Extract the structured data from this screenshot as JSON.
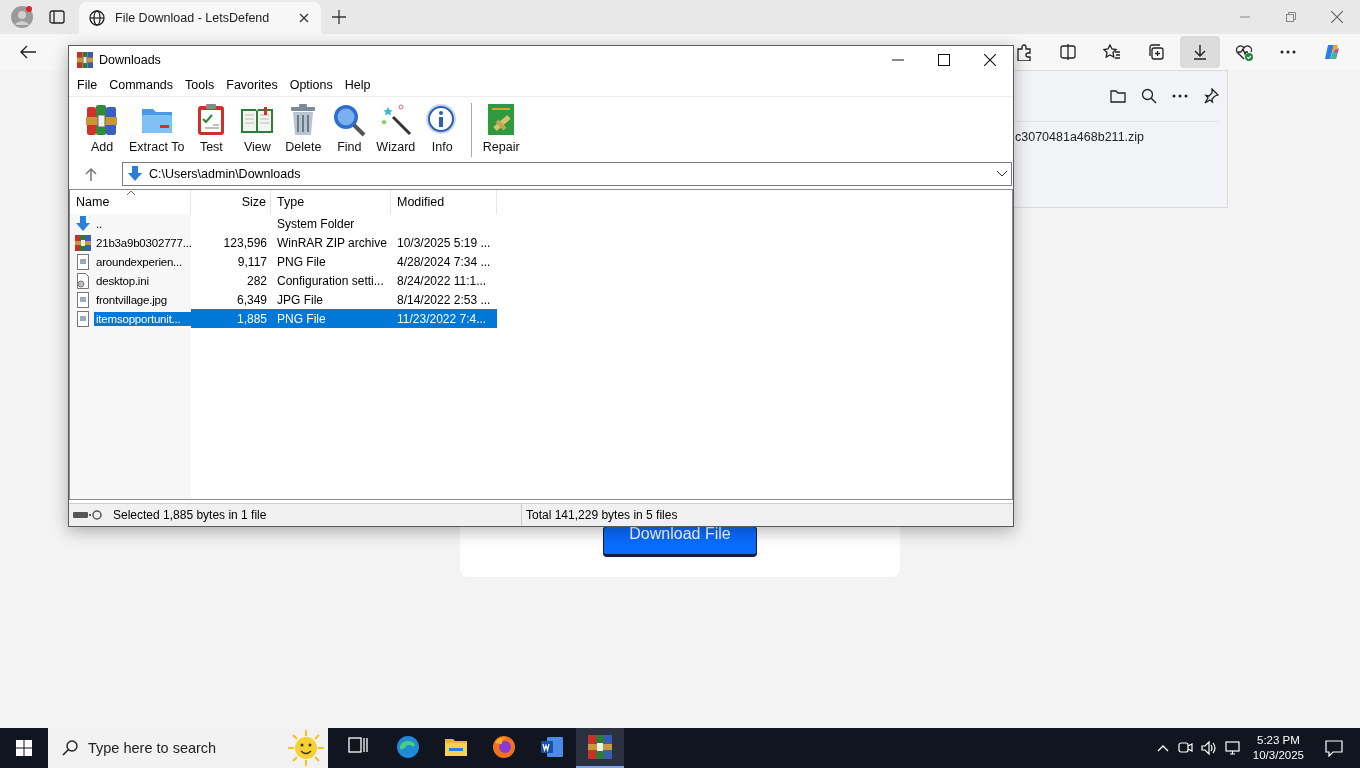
{
  "browser": {
    "tabs": [
      {
        "title": "File Download - LetsDefend",
        "selected": true
      }
    ],
    "toolbar": [
      {
        "kind": "extensions",
        "selected": false
      },
      {
        "kind": "split",
        "selected": false
      },
      {
        "kind": "favorites",
        "selected": false
      },
      {
        "kind": "collections",
        "selected": false
      },
      {
        "kind": "downloads",
        "selected": true
      },
      {
        "kind": "health",
        "selected": false
      },
      {
        "kind": "more",
        "selected": false
      },
      {
        "kind": "copilot",
        "selected": false
      }
    ],
    "downloads_panel": {
      "file_name": "c3070481a468b211.zip"
    },
    "page": {
      "button": "Download File"
    }
  },
  "winrar": {
    "title": "Downloads",
    "menu": [
      "File",
      "Commands",
      "Tools",
      "Favorites",
      "Options",
      "Help"
    ],
    "toolbar": [
      {
        "label": "Add",
        "kind": "add"
      },
      {
        "label": "Extract To",
        "kind": "extract"
      },
      {
        "label": "Test",
        "kind": "test"
      },
      {
        "label": "View",
        "kind": "view"
      },
      {
        "label": "Delete",
        "kind": "delete"
      },
      {
        "label": "Find",
        "kind": "find"
      },
      {
        "label": "Wizard",
        "kind": "wizard"
      },
      {
        "label": "Info",
        "kind": "info"
      },
      {
        "label": "Repair",
        "kind": "repair"
      }
    ],
    "path": "C:\\Users\\admin\\Downloads",
    "columns": [
      "Name",
      "Size",
      "Type",
      "Modified"
    ],
    "rows": [
      {
        "kind": "up",
        "name": "..",
        "size": "",
        "type": "System Folder",
        "modified": "",
        "selected": false
      },
      {
        "kind": "archive",
        "name": "21b3a9b0302777...",
        "size": "123,596",
        "type": "WinRAR ZIP archive",
        "modified": "10/3/2025 5:19 ...",
        "selected": false
      },
      {
        "kind": "image",
        "name": "aroundexperien...",
        "size": "9,117",
        "type": "PNG File",
        "modified": "4/28/2024 7:34 ...",
        "selected": false
      },
      {
        "kind": "settings",
        "name": "desktop.ini",
        "size": "282",
        "type": "Configuration setti...",
        "modified": "8/24/2022 11:1...",
        "selected": false
      },
      {
        "kind": "image",
        "name": "frontvillage.jpg",
        "size": "6,349",
        "type": "JPG File",
        "modified": "8/14/2022 2:53 ...",
        "selected": false
      },
      {
        "kind": "image",
        "name": "itemsopportunit...",
        "size": "1,885",
        "type": "PNG File",
        "modified": "11/23/2022 7:4...",
        "selected": true
      }
    ],
    "status_left": "Selected 1,885 bytes in 1 file",
    "status_right": "Total 141,229 bytes in 5 files"
  },
  "taskbar": {
    "search_placeholder": "Type here to search",
    "apps": [
      {
        "kind": "taskview",
        "active": false
      },
      {
        "kind": "edge",
        "active": false
      },
      {
        "kind": "explorer",
        "active": false
      },
      {
        "kind": "firefox",
        "active": false
      },
      {
        "kind": "word",
        "active": false
      },
      {
        "kind": "winrar",
        "active": true
      }
    ],
    "clock": {
      "time": "5:23 PM",
      "date": "10/3/2025"
    }
  }
}
